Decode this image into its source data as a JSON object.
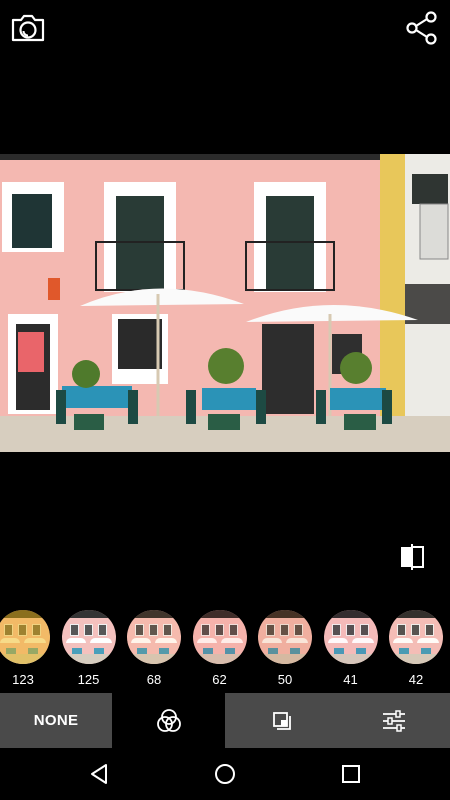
{
  "topbar": {
    "left_icon": "camera-icon",
    "right_icon": "share-icon"
  },
  "photo": {
    "description_icon": "photo-preview"
  },
  "compare": {
    "icon": "compare-icon"
  },
  "filters": [
    {
      "label": "123",
      "tint": "rgba(240,190,40,0.55)"
    },
    {
      "label": "125",
      "tint": "rgba(255,255,255,0.15)"
    },
    {
      "label": "68",
      "tint": "rgba(255,200,150,0.2)"
    },
    {
      "label": "62",
      "tint": "rgba(255,160,140,0.2)"
    },
    {
      "label": "50",
      "tint": "rgba(230,150,100,0.25)"
    },
    {
      "label": "41",
      "tint": "rgba(255,210,220,0.15)"
    },
    {
      "label": "42",
      "tint": "rgba(255,230,200,0.15)"
    }
  ],
  "toolbar": {
    "none_label": "NONE",
    "filters_icon": "filters-icon",
    "crop_icon": "layers-icon",
    "adjust_icon": "sliders-icon"
  },
  "navbar": {
    "back_icon": "back-triangle-icon",
    "home_icon": "home-circle-icon",
    "recents_icon": "recents-square-icon"
  }
}
